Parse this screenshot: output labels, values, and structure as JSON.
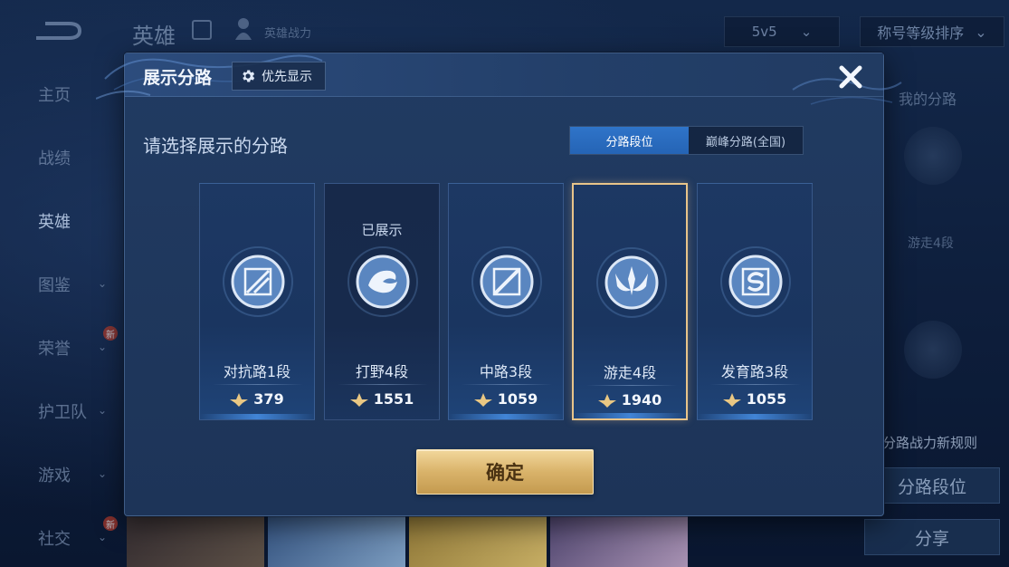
{
  "background": {
    "title": "英雄",
    "power_label": "英雄战力",
    "mode": "5v5",
    "sort": "称号等级排序",
    "sidebar": [
      {
        "label": "主页"
      },
      {
        "label": "战绩"
      },
      {
        "label": "英雄"
      },
      {
        "label": "图鉴"
      },
      {
        "label": "荣誉",
        "badge": "新"
      },
      {
        "label": "护卫队"
      },
      {
        "label": "游戏"
      },
      {
        "label": "社交",
        "badge": "新"
      }
    ],
    "right_panel": {
      "title": "我的分路",
      "rank": "游走4段",
      "rule_link": "分路战力新规则",
      "btn_lane": "分路段位",
      "btn_share": "分享"
    }
  },
  "modal": {
    "title": "展示分路",
    "priority_button": "优先显示",
    "subtitle": "请选择展示的分路",
    "tabs": [
      {
        "label": "分路段位",
        "active": true
      },
      {
        "label": "巅峰分路(全国)",
        "active": false
      }
    ],
    "lanes": [
      {
        "name": "对抗路1段",
        "score": "379",
        "icon": "clash-lane-emblem-icon",
        "shown": "",
        "selected": false,
        "dim": false
      },
      {
        "name": "打野4段",
        "score": "1551",
        "icon": "jungle-emblem-icon",
        "shown": "已展示",
        "selected": false,
        "dim": true
      },
      {
        "name": "中路3段",
        "score": "1059",
        "icon": "mid-lane-emblem-icon",
        "shown": "",
        "selected": false,
        "dim": false
      },
      {
        "name": "游走4段",
        "score": "1940",
        "icon": "roam-emblem-icon",
        "shown": "",
        "selected": true,
        "dim": false
      },
      {
        "name": "发育路3段",
        "score": "1055",
        "icon": "farm-lane-emblem-icon",
        "shown": "",
        "selected": false,
        "dim": false
      }
    ],
    "confirm_button": "确定"
  },
  "colors": {
    "accent_blue": "#2f74c9",
    "selected_border": "#e8c48a",
    "confirm_gold": "#d9b36a"
  }
}
